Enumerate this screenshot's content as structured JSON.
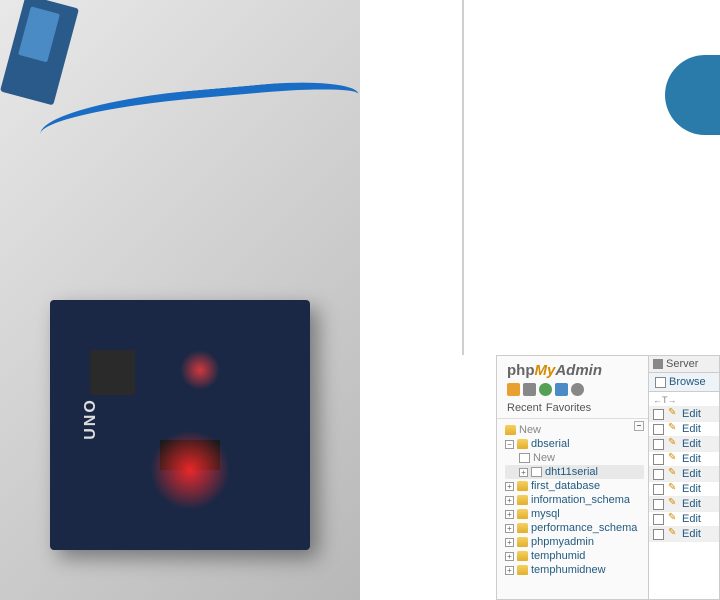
{
  "arduino": {
    "board_label": "UNO"
  },
  "pma": {
    "logo": {
      "php": "php",
      "my": "My",
      "admin": "Admin"
    },
    "tabs": {
      "recent": "Recent",
      "favorites": "Favorites"
    },
    "collapse_symbol": "−",
    "tree": {
      "new_label": "New",
      "items": [
        {
          "name": "dbserial",
          "expanded": true,
          "children": [
            {
              "name": "New",
              "type": "new"
            },
            {
              "name": "dht11serial",
              "type": "table",
              "selected": true
            }
          ]
        },
        {
          "name": "first_database"
        },
        {
          "name": "information_schema"
        },
        {
          "name": "mysql"
        },
        {
          "name": "performance_schema"
        },
        {
          "name": "phpmyadmin"
        },
        {
          "name": "temphumid"
        },
        {
          "name": "temphumidnew"
        }
      ]
    },
    "serverbar": {
      "label": "Server"
    },
    "browse": {
      "label": "Browse"
    },
    "rows": {
      "edit_label": "Edit",
      "header_hint": "Edit",
      "count": 9
    }
  }
}
